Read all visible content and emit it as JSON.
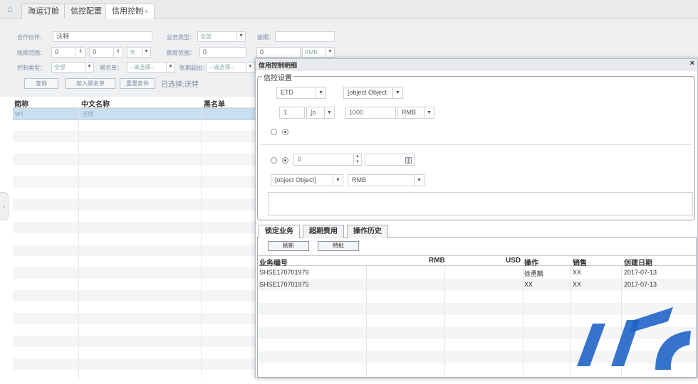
{
  "tabbar": {
    "tabs": [
      {
        "label": "海运订舱"
      },
      {
        "label": "信控配置"
      },
      {
        "label": "信用控制",
        "close": "×"
      }
    ]
  },
  "filter": {
    "unit_label": "合作伙伴：",
    "unit_value": "沃特",
    "biz_type_label": "业务类型：",
    "biz_type_value": "全部",
    "overdue_label": "逾期：",
    "period_label": "账期范围：",
    "period_from": "0",
    "period_to": "0",
    "period_unit": "天",
    "amount_label": "额度范围：",
    "amount_from": "0",
    "amount_to": "0",
    "currency": "RMB",
    "control_type_label": "控制类型：",
    "control_type_value": "全部",
    "blacklist_label": "黑名单：",
    "blacklist_value": "--请选择--",
    "overdue_period_label": "账期超出：",
    "overdue_period_value": "--请选择--",
    "btn_query": "查询",
    "btn_add_blacklist": "加入黑名单",
    "btn_reset": "重置条件",
    "selected_note": "已选择:沃特"
  },
  "bggrid": {
    "headers": [
      "简称",
      "中文名称",
      "黑名单"
    ],
    "rows": [
      [
        "WT",
        "沃特",
        ""
      ]
    ]
  },
  "dialog": {
    "title": "信用控制明细",
    "close": "×",
    "legend": "信控设置",
    "etd_select": "ETD",
    "obj_select_1": "[object Object",
    "days_value": "1",
    "days_unit": "[o",
    "amount_value": "1000",
    "currency_1": "RMB",
    "spin_value": "0",
    "obj_select_2": "[object Object]",
    "currency_2": "RMB",
    "tabs": [
      "锁定业务",
      "超期费用",
      "操作历史"
    ],
    "btn_refresh": "刷新",
    "btn_approve": "特批",
    "grid": {
      "headers": [
        "业务编号",
        "RMB",
        "USD",
        "操作",
        "销售",
        "创建日期"
      ],
      "rows": [
        [
          "SHSE170701979",
          "",
          "",
          "徐勇麟",
          "XX",
          "2017-07-13"
        ],
        [
          "SHSE170701975",
          "",
          "",
          "XX",
          "XX",
          "2017-07-13"
        ]
      ]
    }
  },
  "colors": {
    "selected_row": "#c8dff2",
    "watermark": "#1f64c8"
  }
}
